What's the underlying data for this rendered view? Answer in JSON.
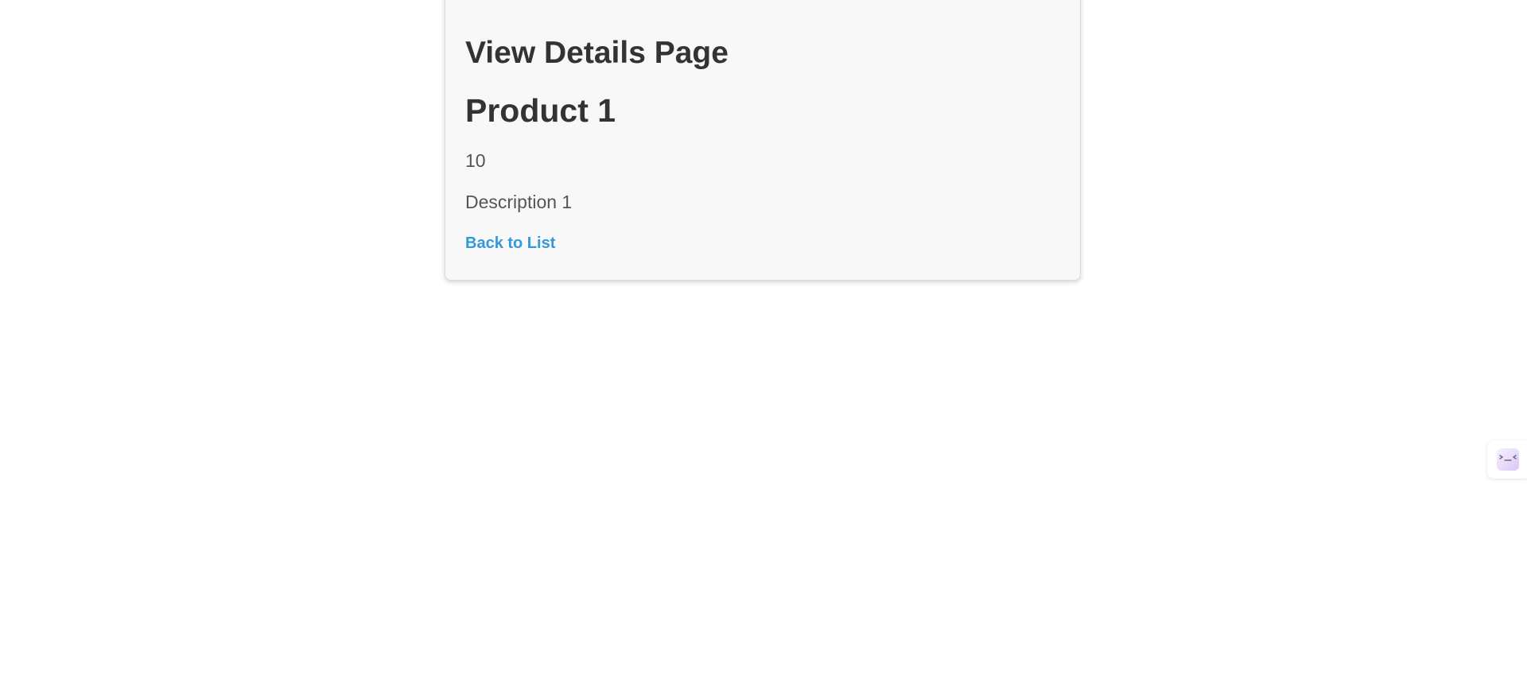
{
  "page": {
    "title": "View Details Page"
  },
  "product": {
    "name": "Product 1",
    "price": "10",
    "description": "Description 1"
  },
  "actions": {
    "back_label": "Back to List"
  },
  "colors": {
    "link": "#3498db",
    "heading": "#333333",
    "body_text": "#555555",
    "card_background": "#f8f8f8"
  },
  "side_widget": {
    "icon": "assistant-face-icon"
  }
}
